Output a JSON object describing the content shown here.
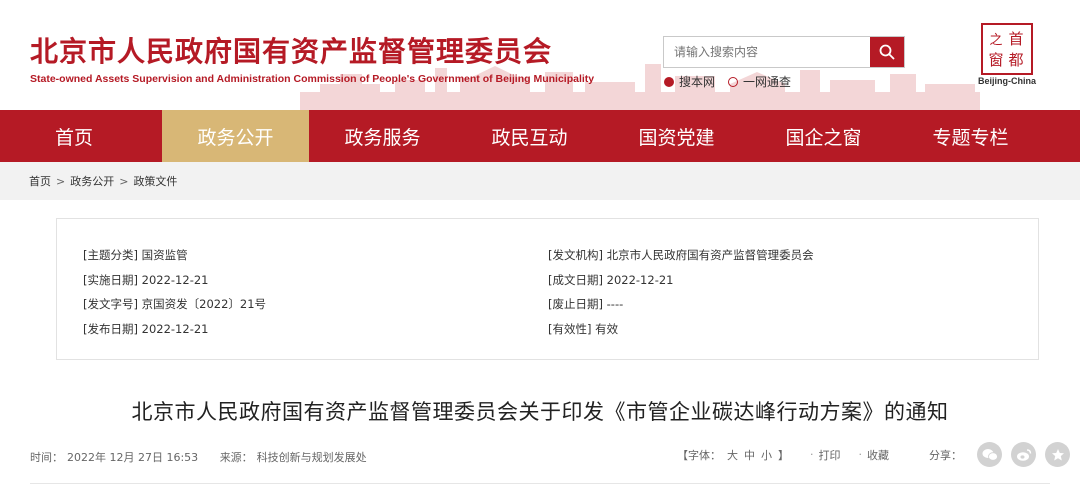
{
  "header": {
    "title": "北京市人民政府国有资产监督管理委员会",
    "subtitle": "State-owned Assets Supervision and Administration Commission of People's Government of Beijing Municipality",
    "search_placeholder": "请输入搜索内容",
    "scope_options": [
      "搜本网",
      "一网通查"
    ],
    "logo_text": [
      "首",
      "都",
      "之",
      "窗"
    ],
    "logo_caption": "Beijing-China",
    "brand_color": "#b51a25"
  },
  "nav": {
    "items": [
      "首页",
      "政务公开",
      "政务服务",
      "政民互动",
      "国资党建",
      "国企之窗",
      "专题专栏"
    ],
    "active_index": 1,
    "active_color": "#d8b776"
  },
  "breadcrumb": {
    "items": [
      "首页",
      "政务公开",
      "政策文件"
    ],
    "separator": ">"
  },
  "meta": {
    "left": [
      {
        "label": "[主题分类]",
        "value": "国资监管"
      },
      {
        "label": "[实施日期]",
        "value": "2022-12-21"
      },
      {
        "label": "[发文字号]",
        "value": "京国资发〔2022〕21号"
      },
      {
        "label": "[发布日期]",
        "value": "2022-12-21"
      }
    ],
    "right": [
      {
        "label": "[发文机构]",
        "value": "北京市人民政府国有资产监督管理委员会"
      },
      {
        "label": "[成文日期]",
        "value": "2022-12-21"
      },
      {
        "label": "[废止日期]",
        "value": "----"
      },
      {
        "label": "[有效性]",
        "value": "有效"
      }
    ]
  },
  "article": {
    "title": "北京市人民政府国有资产监督管理委员会关于印发《市管企业碳达峰行动方案》的通知",
    "time_label": "时间：",
    "time": "2022年 12月 27日 16:53",
    "source_label": "来源：",
    "source": "科技创新与规划发展处"
  },
  "tools": {
    "font_label_open": "【字体：",
    "font_sizes": [
      "大",
      "中",
      "小"
    ],
    "font_label_close": "】",
    "print": "打印",
    "favorite": "收藏",
    "share_label": "分享：",
    "share_icons": [
      "wechat-icon",
      "weibo-icon",
      "star-icon"
    ]
  }
}
